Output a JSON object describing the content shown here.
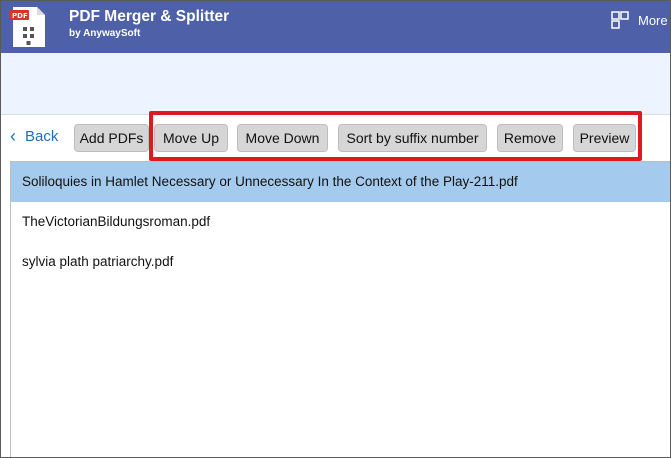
{
  "app": {
    "title": "PDF Merger & Splitter",
    "subtitle": "by AnywaySoft",
    "icon": "pdf-document-icon",
    "brand_color": "#4d60a8"
  },
  "header": {
    "more_label": "More",
    "more_icon": "app-grid-icon"
  },
  "toolbar": {
    "back_label": "Back",
    "back_icon": "chevron-left-icon",
    "add_pdfs": "Add PDFs",
    "move_up": "Move Up",
    "move_down": "Move Down",
    "sort_suffix": "Sort by suffix number",
    "remove": "Remove",
    "preview": "Preview"
  },
  "files": [
    {
      "name": "Soliloquies in Hamlet Necessary or Unnecessary In the Context of the Play-211.pdf",
      "selected": true
    },
    {
      "name": "TheVictorianBildungsroman.pdf",
      "selected": false
    },
    {
      "name": "sylvia plath patriarchy.pdf",
      "selected": false
    }
  ],
  "colors": {
    "selection": "#a4cbed",
    "highlight_border": "#e0191f",
    "link": "#1f6fbf"
  }
}
